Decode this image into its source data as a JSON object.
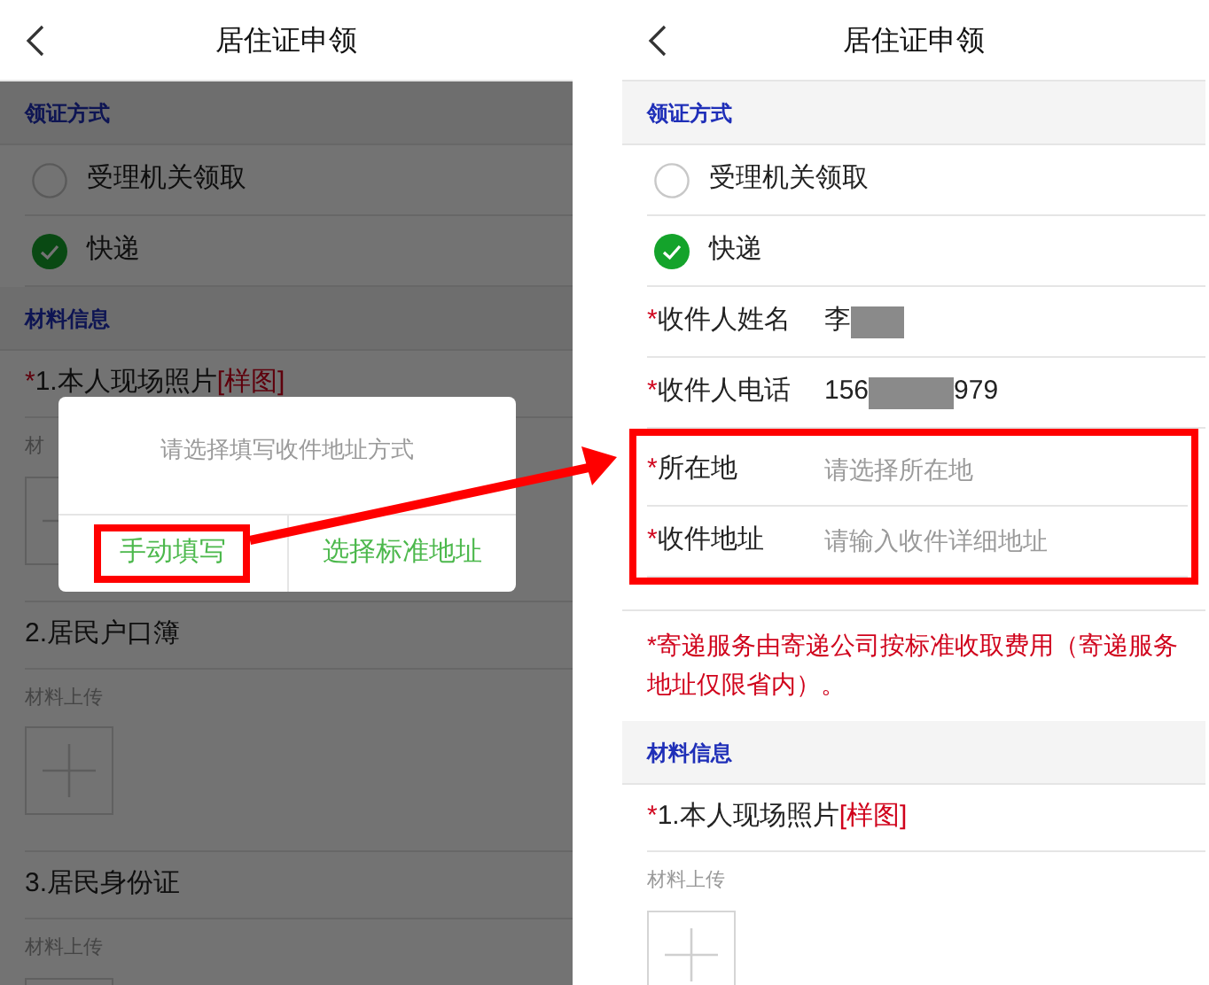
{
  "left_screen": {
    "header": {
      "title": "居住证申领"
    },
    "rows": [
      {
        "kind": "section",
        "label": "领证方式"
      },
      {
        "kind": "radio",
        "label": "受理机关领取",
        "selected": false
      },
      {
        "kind": "radio",
        "label": "快递",
        "selected": true
      },
      {
        "kind": "section",
        "label": "材料信息"
      },
      {
        "kind": "material",
        "mark": "*",
        "label": "1.本人现场照片",
        "link": "[样图]"
      },
      {
        "kind": "upload",
        "label": "材"
      },
      {
        "kind": "material",
        "label": "2.居民户口簿"
      },
      {
        "kind": "upload",
        "label": "材料上传"
      },
      {
        "kind": "material",
        "label": "3.居民身份证"
      },
      {
        "kind": "upload",
        "label": "材料上传"
      }
    ],
    "dialog": {
      "message": "请选择填写收件地址方式",
      "buttons": [
        {
          "label": "手动填写",
          "highlighted": true
        },
        {
          "label": "选择标准地址",
          "highlighted": false
        }
      ]
    }
  },
  "right_screen": {
    "header": {
      "title": "居住证申领"
    },
    "rows": [
      {
        "kind": "section",
        "label": "领证方式"
      },
      {
        "kind": "radio",
        "label": "受理机关领取",
        "selected": false
      },
      {
        "kind": "radio",
        "label": "快递",
        "selected": true
      },
      {
        "kind": "field",
        "mark": "*",
        "label": "收件人姓名",
        "value": "李",
        "redacted": true
      },
      {
        "kind": "field",
        "mark": "*",
        "label": "收件人电话",
        "value": "156",
        "redacted": true,
        "value_after": "979"
      },
      {
        "kind": "group",
        "highlighted": true,
        "children": [
          {
            "kind": "field",
            "mark": "*",
            "label": "所在地",
            "placeholder": "请选择所在地"
          },
          {
            "kind": "field",
            "mark": "*",
            "label": "收件地址",
            "placeholder": "请输入收件详细地址"
          }
        ]
      },
      {
        "kind": "notice",
        "text": "*寄递服务由寄递公司按标准收取费用（寄递服务地址仅限省内）。"
      },
      {
        "kind": "section",
        "label": "材料信息"
      },
      {
        "kind": "material",
        "mark": "*",
        "label": "1.本人现场照片",
        "link": "[样图]"
      },
      {
        "kind": "upload",
        "label": "材料上传"
      }
    ]
  }
}
